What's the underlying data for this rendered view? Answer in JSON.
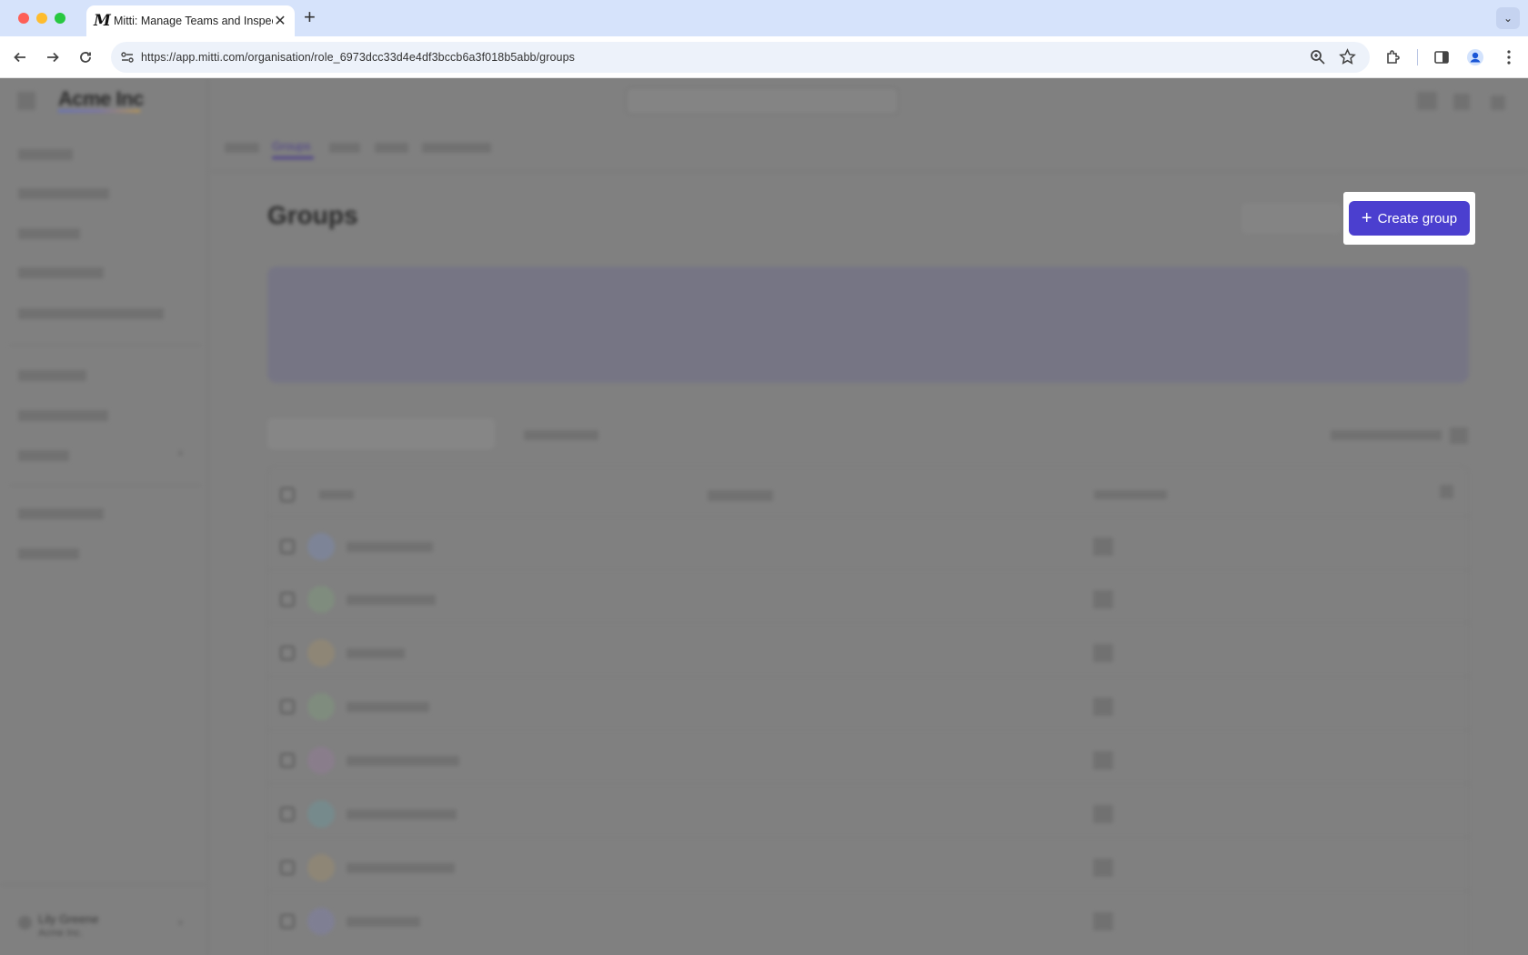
{
  "browser": {
    "tab_title": "Mitti: Manage Teams and Inspect...",
    "tab_logo": "M",
    "url": "https://app.mitti.com/organisation/role_6973dcc33d4e4df3bccb6a3f018b5abb/groups",
    "icons": [
      "back-icon",
      "forward-icon",
      "reload-icon",
      "site-settings-icon",
      "zoom-icon",
      "bookmark-star-icon",
      "extensions-icon",
      "side-panel-icon",
      "profile-icon",
      "more-menu-icon"
    ]
  },
  "app": {
    "brand": "Acme Inc",
    "active_tab": "Groups",
    "page_title": "Groups",
    "create_button_label": "Create group",
    "user": {
      "name": "Lily Greene",
      "org": "Acme Inc."
    }
  },
  "colors": {
    "accent": "#4b3fcf",
    "overlay": "#808080"
  }
}
